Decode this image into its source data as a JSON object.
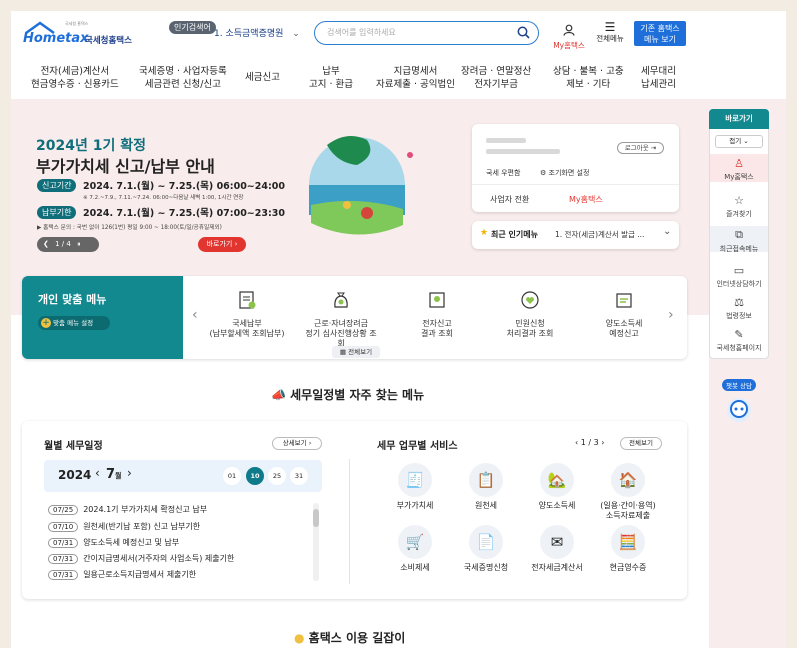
{
  "header": {
    "logo_small": "국세청 홈택스",
    "logo_text": "Hometax",
    "logo_org": "국세청홈택스",
    "hot_search_label": "인기검색어",
    "hot_search_value": "1. 소득금액증명원",
    "search_placeholder": "검색어를 입력하세요",
    "my_label": "My홈택스",
    "menu_label": "전체메뉴",
    "old_btn_line1": "기존 홈택스",
    "old_btn_line2": "메뉴 보기"
  },
  "nav": [
    {
      "l1": "전자(세금)계산서",
      "l2": "현금영수증 · 신용카드"
    },
    {
      "l1": "국세증명 · 사업자등록",
      "l2": "세금관련 신청/신고"
    },
    {
      "l1": "세금신고",
      "l2": ""
    },
    {
      "l1": "납부",
      "l2": "고지 · 환급"
    },
    {
      "l1": "지급명세서",
      "l2": "자료제출 · 공익법인"
    },
    {
      "l1": "장려금 · 연말정산",
      "l2": "전자기부금"
    },
    {
      "l1": "상담 · 불복 · 고충",
      "l2": "제보 · 기타"
    },
    {
      "l1": "세무대리",
      "l2": "납세관리"
    }
  ],
  "hero": {
    "line1": "2024년 1기 확정",
    "line2": "부가가치세 신고/납부 안내",
    "period1_label": "신고기간",
    "period1": "2024. 7.1.(월) ~ 7.25.(목) 06:00~24:00",
    "note": "※ 7.2.~7.9., 7.11.~7.24. 06:00~다음날 새벽 1:00, 1시간 연장",
    "period2_label": "납부기한",
    "period2": "2024. 7.1.(월) ~ 7.25.(목) 07:00~23:30",
    "inquiry": "▶ 홈택스 문의 : 국번 없이 126(1번) 평일 9:00 ~ 18:00(토/일/공휴일제외)",
    "pager": "1 / 4",
    "go_btn": "바로가기"
  },
  "login_card": {
    "logout": "로그아웃",
    "mailbox": "국세 우편함",
    "screen_setting": "조기화면 설정",
    "switch_biz": "사업자 전환",
    "my": "My홈택스"
  },
  "recent": {
    "label": "최근 인기메뉴",
    "value": "1. 전자(세금)계산서 발급 ..."
  },
  "custom_menu": {
    "title": "개인 맞춤 메뉴",
    "setting": "맞춤 메뉴 설정",
    "view_all": "전체보기",
    "items": [
      {
        "l1": "국세납부",
        "l2": "(납부할세액 조회납부)"
      },
      {
        "l1": "근로·자녀장려금",
        "l2": "정기 심사진행상황 조회"
      },
      {
        "l1": "전자신고",
        "l2": "결과 조회"
      },
      {
        "l1": "민원신청",
        "l2": "처리결과 조회"
      },
      {
        "l1": "양도소득세",
        "l2": "예정신고"
      }
    ]
  },
  "side_rail": {
    "title": "바로가기",
    "fold": "접기",
    "items": [
      "My홈택스",
      "즐겨찾기",
      "최근접속메뉴",
      "인터넷상담하기",
      "법령정보",
      "국세청홈페이지"
    ],
    "chatbot": "챗봇 상담"
  },
  "section_title": "세무일정별 자주 찾는 메뉴",
  "schedule": {
    "title": "월별 세무일정",
    "detail": "상세보기",
    "year": "2024",
    "month": "7",
    "month_suffix": "월",
    "days": [
      "01",
      "10",
      "25",
      "31"
    ],
    "items": [
      {
        "date": "07/25",
        "text": "2024.1기 부가가치세 확정신고 납부"
      },
      {
        "date": "07/10",
        "text": "원천세(반기납 포함) 신고 납부기한"
      },
      {
        "date": "07/31",
        "text": "양도소득세 예정신고 및 납부"
      },
      {
        "date": "07/31",
        "text": "간이지급명세서(거주자의 사업소득) 제출기한"
      },
      {
        "date": "07/31",
        "text": "일용근로소득지급명세서 제출기한"
      }
    ]
  },
  "services": {
    "title": "세무 업무별 서비스",
    "pager": "1 / 3",
    "view_all": "전체보기",
    "items": [
      {
        "l1": "부가가치세",
        "l2": "",
        "icon": "🧾"
      },
      {
        "l1": "원천세",
        "l2": "",
        "icon": "📋"
      },
      {
        "l1": "양도소득세",
        "l2": "",
        "icon": "🏡"
      },
      {
        "l1": "(일용·간이·용역)",
        "l2": "소득자료제출",
        "icon": "🏠"
      },
      {
        "l1": "소비제세",
        "l2": "",
        "icon": "🛒"
      },
      {
        "l1": "국세증명신청",
        "l2": "",
        "icon": "📄"
      },
      {
        "l1": "전자세금계산서",
        "l2": "",
        "icon": "✉"
      },
      {
        "l1": "현금영수증",
        "l2": "",
        "icon": "🧮"
      }
    ]
  },
  "bottom_title": "홈택스 이용 길잡이",
  "colors": {
    "brand": "#1e6fd9",
    "teal": "#12888f",
    "hero_bg": "#f9ecec",
    "red": "#e2352f"
  }
}
